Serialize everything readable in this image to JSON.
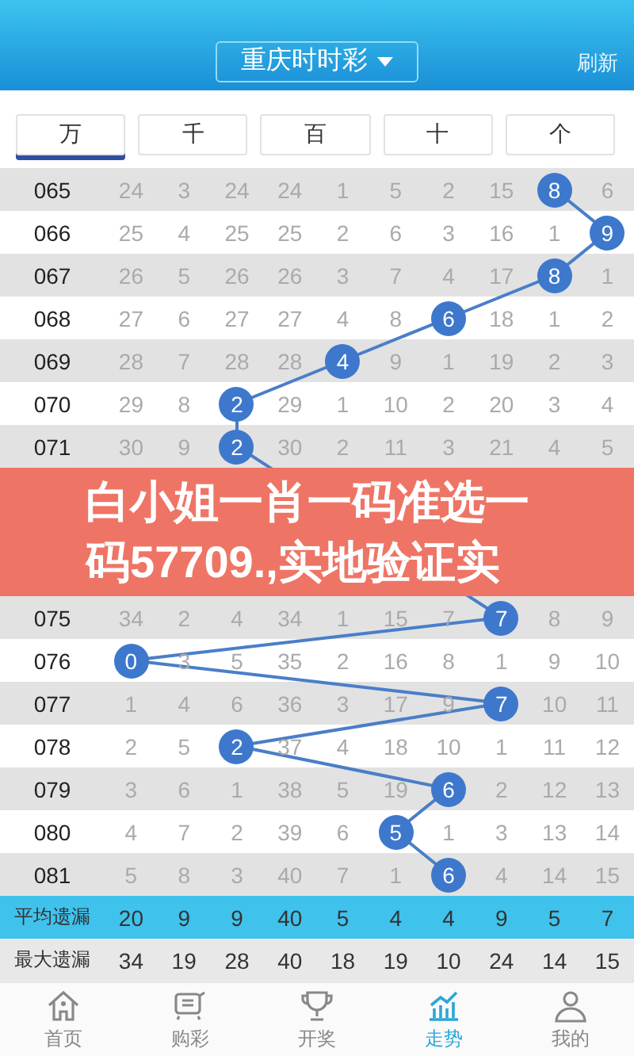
{
  "header": {
    "title": "重庆时时彩",
    "action": "刷新"
  },
  "tabs": [
    {
      "label": "万",
      "selected": true
    },
    {
      "label": "千",
      "selected": false
    },
    {
      "label": "百",
      "selected": false
    },
    {
      "label": "十",
      "selected": false
    },
    {
      "label": "个",
      "selected": false
    }
  ],
  "table": {
    "rows": [
      {
        "kind": "draw",
        "period": "065",
        "cells": [
          "24",
          "3",
          "24",
          "24",
          "1",
          "5",
          "2",
          "15",
          {
            "ball": "8"
          },
          "6"
        ]
      },
      {
        "kind": "draw",
        "period": "066",
        "cells": [
          "25",
          "4",
          "25",
          "25",
          "2",
          "6",
          "3",
          "16",
          "1",
          {
            "ball": "9"
          }
        ]
      },
      {
        "kind": "draw",
        "period": "067",
        "cells": [
          "26",
          "5",
          "26",
          "26",
          "3",
          "7",
          "4",
          "17",
          {
            "ball": "8"
          },
          "1"
        ]
      },
      {
        "kind": "draw",
        "period": "068",
        "cells": [
          "27",
          "6",
          "27",
          "27",
          "4",
          "8",
          {
            "ball": "6"
          },
          "18",
          "1",
          "2"
        ]
      },
      {
        "kind": "draw",
        "period": "069",
        "cells": [
          "28",
          "7",
          "28",
          "28",
          {
            "ball": "4"
          },
          "9",
          "1",
          "19",
          "2",
          "3"
        ]
      },
      {
        "kind": "draw",
        "period": "070",
        "cells": [
          "29",
          "8",
          {
            "ball": "2"
          },
          "29",
          "1",
          "10",
          "2",
          "20",
          "3",
          "4"
        ]
      },
      {
        "kind": "draw",
        "period": "071",
        "cells": [
          "30",
          "9",
          {
            "ball": "2"
          },
          "30",
          "2",
          "11",
          "3",
          "21",
          "4",
          "5"
        ]
      },
      {
        "kind": "banner",
        "text": "白小姐一肖一码准选一码57709.,实地验证实"
      },
      {
        "kind": "draw",
        "period": "075",
        "cells": [
          "34",
          "2",
          "4",
          "34",
          "1",
          "15",
          "7",
          {
            "ball": "7"
          },
          "8",
          "9"
        ]
      },
      {
        "kind": "draw",
        "period": "076",
        "cells": [
          {
            "ball": "0"
          },
          "3",
          "5",
          "35",
          "2",
          "16",
          "8",
          "1",
          "9",
          "10"
        ]
      },
      {
        "kind": "draw",
        "period": "077",
        "cells": [
          "1",
          "4",
          "6",
          "36",
          "3",
          "17",
          "9",
          {
            "ball": "7"
          },
          "10",
          "11"
        ]
      },
      {
        "kind": "draw",
        "period": "078",
        "cells": [
          "2",
          "5",
          {
            "ball": "2"
          },
          "37",
          "4",
          "18",
          "10",
          "1",
          "11",
          "12"
        ]
      },
      {
        "kind": "draw",
        "period": "079",
        "cells": [
          "3",
          "6",
          "1",
          "38",
          "5",
          "19",
          {
            "ball": "6"
          },
          "2",
          "12",
          "13"
        ]
      },
      {
        "kind": "draw",
        "period": "080",
        "cells": [
          "4",
          "7",
          "2",
          "39",
          "6",
          {
            "ball": "5"
          },
          "1",
          "3",
          "13",
          "14"
        ]
      },
      {
        "kind": "draw",
        "period": "081",
        "cells": [
          "5",
          "8",
          "3",
          "40",
          "7",
          "1",
          {
            "ball": "6"
          },
          "4",
          "14",
          "15"
        ]
      }
    ],
    "stats": [
      {
        "kind": "average",
        "label": "平均遗漏",
        "values": [
          "20",
          "9",
          "9",
          "40",
          "5",
          "4",
          "4",
          "9",
          "5",
          "7"
        ]
      },
      {
        "kind": "max",
        "label": "最大遗漏",
        "values": [
          "34",
          "19",
          "28",
          "40",
          "18",
          "19",
          "10",
          "24",
          "14",
          "15"
        ]
      }
    ]
  },
  "nav": [
    {
      "kind": "home",
      "label": "首页",
      "selected": false
    },
    {
      "kind": "cart",
      "label": "购彩",
      "selected": false
    },
    {
      "kind": "trophy",
      "label": "开奖",
      "selected": false
    },
    {
      "kind": "trend",
      "label": "走势",
      "selected": true
    },
    {
      "kind": "user",
      "label": "我的",
      "selected": false
    }
  ]
}
